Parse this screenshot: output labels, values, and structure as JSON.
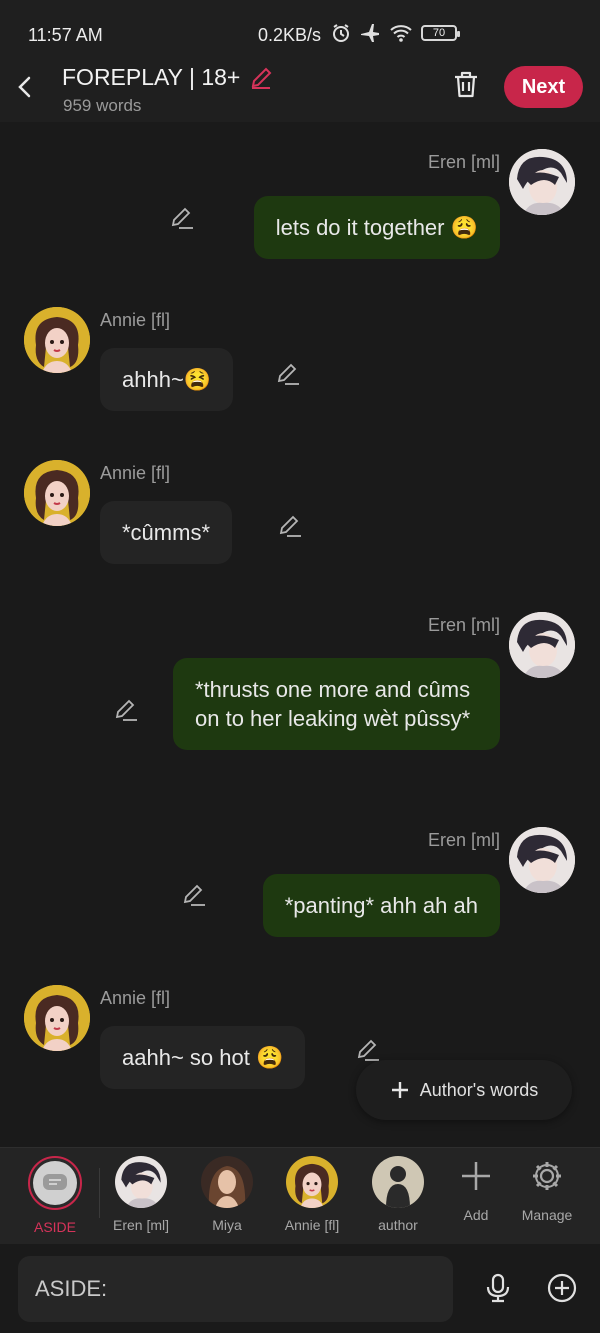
{
  "status_bar": {
    "time": "11:57 AM",
    "network_speed": "0.2KB/s",
    "battery": "70",
    "icons": [
      "alarm-icon",
      "airplane-icon",
      "wifi-icon",
      "battery-icon"
    ]
  },
  "header": {
    "title": "FOREPLAY | 18+",
    "subtitle": "959 words",
    "next_label": "Next"
  },
  "colors": {
    "accent": "#c8264a",
    "user_bubble": "#1e3910",
    "other_bubble": "#242424"
  },
  "messages": [
    {
      "sender": "Eren [ml]",
      "text": "lets do it together 😩"
    },
    {
      "sender": "Annie [fl]",
      "text": "ahhh~😫"
    },
    {
      "sender": "Annie [fl]",
      "text": "*cûmms*"
    },
    {
      "sender": "Eren [ml]",
      "text": "*thrusts one more and cûms on to her leaking wèt pûssy*"
    },
    {
      "sender": "Eren [ml]",
      "text": "*panting* ahh ah ah"
    },
    {
      "sender": "Annie [fl]",
      "text": "aahh~ so hot 😩"
    }
  ],
  "authors_words_label": "Author's words",
  "characters": [
    {
      "label": "ASIDE",
      "active": true
    },
    {
      "label": "Eren [ml]"
    },
    {
      "label": "Miya"
    },
    {
      "label": "Annie [fl]"
    },
    {
      "label": "author"
    },
    {
      "label": "Add"
    },
    {
      "label": "Manage"
    }
  ],
  "composer": {
    "placeholder": "ASIDE:"
  }
}
